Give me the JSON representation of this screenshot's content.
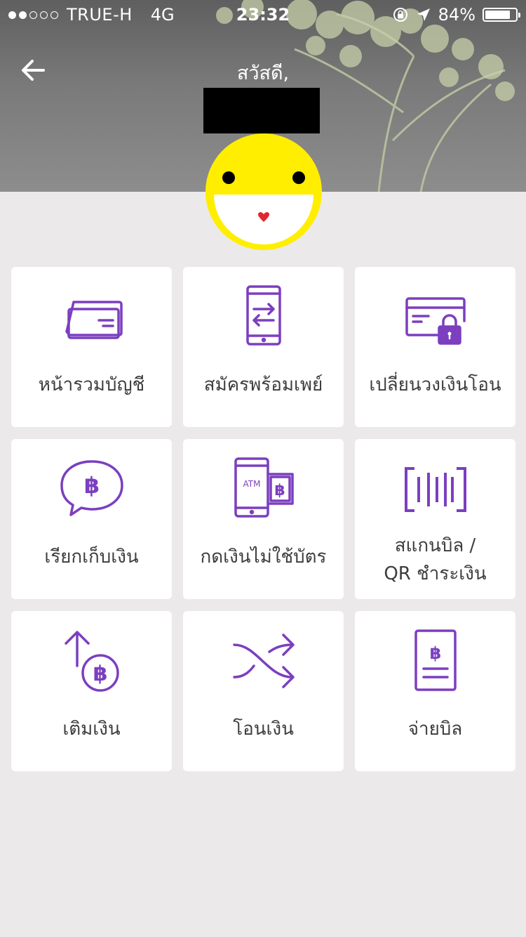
{
  "status_bar": {
    "signal_dots": [
      true,
      true,
      false,
      false,
      false
    ],
    "carrier": "TRUE-H",
    "network": "4G",
    "time": "23:32",
    "battery_percent": "84%",
    "battery_level": 0.84
  },
  "header": {
    "greeting": "สวัสดี,"
  },
  "colors": {
    "accent_purple": "#7b3fbf",
    "avatar_yellow": "#ffee00",
    "background": "#ebe9ea"
  },
  "menu": [
    {
      "id": "account-summary",
      "label": "หน้ารวมบัญชี",
      "icon": "card-icon"
    },
    {
      "id": "promptpay-register",
      "label": "สมัครพร้อมเพย์",
      "icon": "phone-transfer-icon"
    },
    {
      "id": "change-transfer-limit",
      "label": "เปลี่ยนวงเงินโอน",
      "icon": "card-lock-icon"
    },
    {
      "id": "request-money",
      "label": "เรียกเก็บเงิน",
      "icon": "baht-chat-icon"
    },
    {
      "id": "cardless-withdraw",
      "label": "กดเงินไม่ใช้บัตร",
      "icon": "atm-phone-icon"
    },
    {
      "id": "scan-bill-qr",
      "label": "สแกนบิล /\nQR ชำระเงิน",
      "icon": "barcode-scan-icon"
    },
    {
      "id": "top-up",
      "label": "เติมเงิน",
      "icon": "topup-baht-icon"
    },
    {
      "id": "transfer",
      "label": "โอนเงิน",
      "icon": "shuffle-arrows-icon"
    },
    {
      "id": "pay-bill",
      "label": "จ่ายบิล",
      "icon": "bill-icon"
    }
  ]
}
